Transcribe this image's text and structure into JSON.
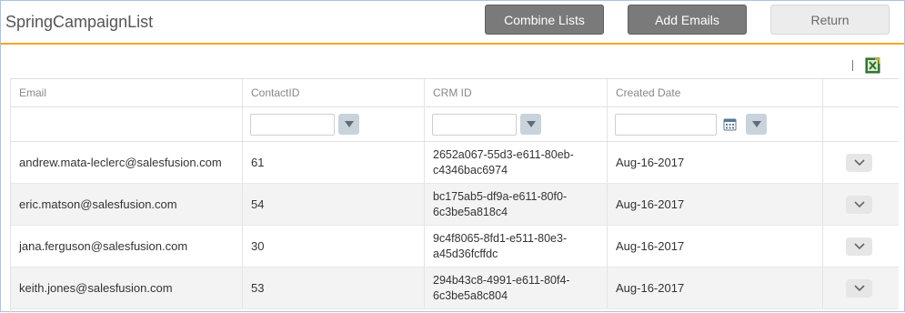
{
  "header": {
    "title": "SpringCampaignList",
    "combine_label": "Combine Lists",
    "add_emails_label": "Add Emails",
    "return_label": "Return"
  },
  "toolbar": {
    "export_icon": "excel-export-icon"
  },
  "grid": {
    "columns": [
      "Email",
      "ContactID",
      "CRM ID",
      "Created Date",
      ""
    ],
    "rows": [
      {
        "email": "andrew.mata-leclerc@salesfusion.com",
        "contact_id": "61",
        "crm_id_1": "2652a067-55d3-e611-80eb-",
        "crm_id_2": "c4346bac6974",
        "created": "Aug-16-2017"
      },
      {
        "email": "eric.matson@salesfusion.com",
        "contact_id": "54",
        "crm_id_1": "bc175ab5-df9a-e611-80f0-",
        "crm_id_2": "6c3be5a818c4",
        "created": "Aug-16-2017"
      },
      {
        "email": "jana.ferguson@salesfusion.com",
        "contact_id": "30",
        "crm_id_1": "9c4f8065-8fd1-e511-80e3-",
        "crm_id_2": "a45d36fcffdc",
        "created": "Aug-16-2017"
      },
      {
        "email": "keith.jones@salesfusion.com",
        "contact_id": "53",
        "crm_id_1": "294b43c8-4991-e611-80f4-",
        "crm_id_2": "6c3be5a8c804",
        "created": "Aug-16-2017"
      }
    ]
  },
  "colors": {
    "accent": "#f5a623",
    "button_dark": "#7a7a7a",
    "button_light": "#ececec",
    "row_alt": "#f3f3f3"
  }
}
